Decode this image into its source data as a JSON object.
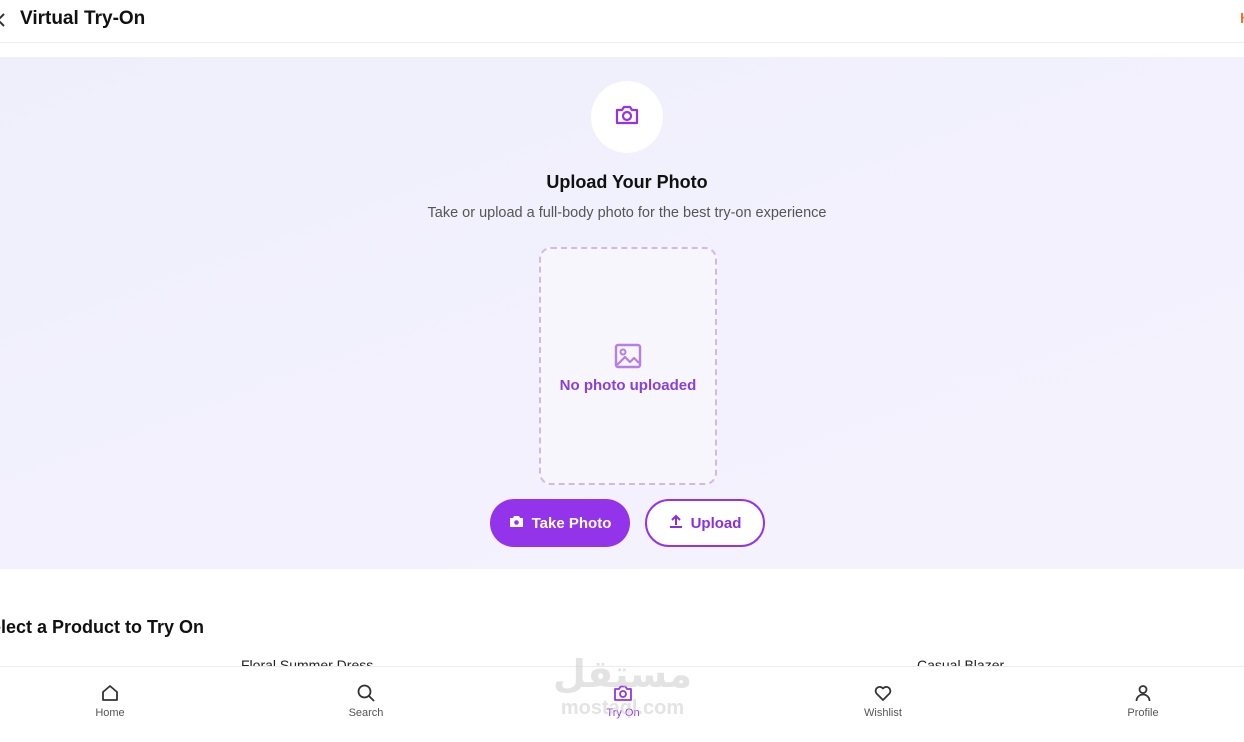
{
  "header": {
    "title": "Virtual Try-On",
    "edge_mark": "H"
  },
  "upload": {
    "title": "Upload Your Photo",
    "subtitle": "Take or upload a full-body photo for the best try-on experience",
    "placeholder": "No photo uploaded",
    "take_photo_label": "Take Photo",
    "upload_label": "Upload"
  },
  "products": {
    "section_title": "elect a Product to Try On",
    "items": [
      {
        "name": "Floral Summer Dress"
      },
      {
        "name": "Casual Blazer"
      }
    ]
  },
  "nav": {
    "items": [
      {
        "label": "Home",
        "icon": "home-icon"
      },
      {
        "label": "Search",
        "icon": "search-icon"
      },
      {
        "label": "Try On",
        "icon": "camera-icon",
        "active": true
      },
      {
        "label": "Wishlist",
        "icon": "heart-icon"
      },
      {
        "label": "Profile",
        "icon": "user-icon"
      }
    ]
  },
  "watermark": {
    "arabic": "مستقل",
    "latin": "mostaql.com"
  },
  "colors": {
    "accent": "#9333ea",
    "panel_bg": "#efeffc",
    "dashed_border": "#d6b4f2"
  }
}
